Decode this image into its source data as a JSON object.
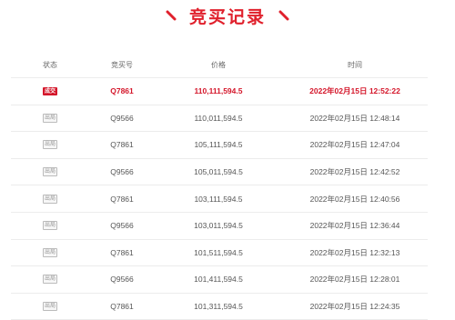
{
  "page": {
    "title": "竞买记录",
    "accent_color": "#d4162a",
    "left_icon": "slash-deco-icon",
    "right_icon": "slash-deco-icon"
  },
  "table": {
    "headers": {
      "status": "状态",
      "bid_number": "竞买号",
      "price": "价格",
      "time": "时间"
    },
    "rows": [
      {
        "status": "成交",
        "bid_number": "Q7861",
        "price": "110,111,594.5",
        "time": "2022年02月15日 12:52:22"
      },
      {
        "status": "出局",
        "bid_number": "Q9566",
        "price": "110,011,594.5",
        "time": "2022年02月15日 12:48:14"
      },
      {
        "status": "出局",
        "bid_number": "Q7861",
        "price": "105,111,594.5",
        "time": "2022年02月15日 12:47:04"
      },
      {
        "status": "出局",
        "bid_number": "Q9566",
        "price": "105,011,594.5",
        "time": "2022年02月15日 12:42:52"
      },
      {
        "status": "出局",
        "bid_number": "Q7861",
        "price": "103,111,594.5",
        "time": "2022年02月15日 12:40:56"
      },
      {
        "status": "出局",
        "bid_number": "Q9566",
        "price": "103,011,594.5",
        "time": "2022年02月15日 12:36:44"
      },
      {
        "status": "出局",
        "bid_number": "Q7861",
        "price": "101,511,594.5",
        "time": "2022年02月15日 12:32:13"
      },
      {
        "status": "出局",
        "bid_number": "Q9566",
        "price": "101,411,594.5",
        "time": "2022年02月15日 12:28:01"
      },
      {
        "status": "出局",
        "bid_number": "Q7861",
        "price": "101,311,594.5",
        "time": "2022年02月15日 12:24:35"
      }
    ]
  }
}
